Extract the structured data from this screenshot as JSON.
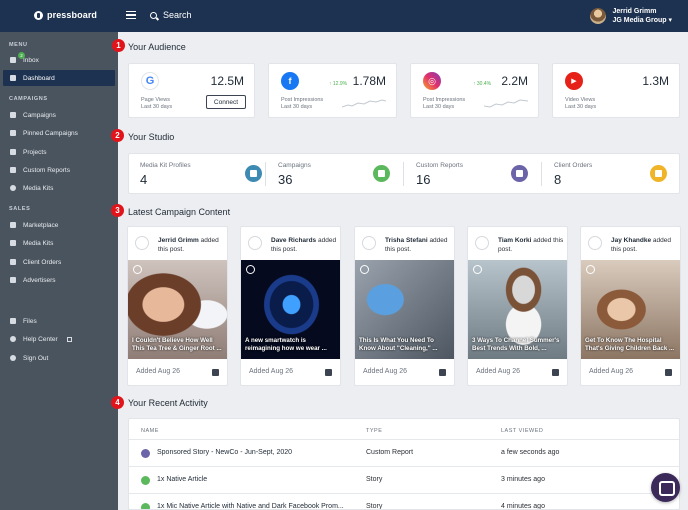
{
  "topbar": {
    "logo": "pressboard",
    "search_label": "Search",
    "user_name": "Jerrid Grimm",
    "org_name": "JG Media Group ▾"
  },
  "sidebar": {
    "menu_heading": "MENU",
    "inbox": "Inbox",
    "inbox_badge": "2",
    "dashboard": "Dashboard",
    "campaigns_heading": "CAMPAIGNS",
    "campaigns": "Campaigns",
    "pinned": "Pinned Campaigns",
    "projects": "Projects",
    "custom_reports": "Custom Reports",
    "media_kits": "Media Kits",
    "sales_heading": "SALES",
    "marketplace": "Marketplace",
    "media_kits_sales": "Media Kits",
    "client_orders": "Client Orders",
    "advertisers": "Advertisers",
    "files": "Files",
    "help_center": "Help Center",
    "sign_out": "Sign Out"
  },
  "steps": [
    "1",
    "2",
    "3",
    "4"
  ],
  "audience": {
    "title": "Your Audience",
    "google": {
      "value": "12.5M",
      "label1": "Page Views",
      "label2": "Last 30 days",
      "button": "Connect"
    },
    "facebook": {
      "value": "1.78M",
      "pct": "↑ 12.9%",
      "label1": "Post Impressions",
      "label2": "Last 30 days"
    },
    "instagram": {
      "value": "2.2M",
      "pct": "↑ 30.4%",
      "label1": "Post Impressions",
      "label2": "Last 30 days"
    },
    "youtube": {
      "value": "1.3M",
      "label1": "Video Views",
      "label2": "Last 30 days"
    }
  },
  "studio": {
    "title": "Your Studio",
    "items": [
      {
        "label": "Media Kit Profiles",
        "num": "4",
        "color": "#3d8bb3"
      },
      {
        "label": "Campaigns",
        "num": "36",
        "color": "#5cb85c"
      },
      {
        "label": "Custom Reports",
        "num": "16",
        "color": "#6c64a8"
      },
      {
        "label": "Client Orders",
        "num": "8",
        "color": "#f0b429"
      }
    ]
  },
  "content": {
    "title": "Latest Campaign Content",
    "added_suffix": "added this post.",
    "cards": [
      {
        "author": "Jerrid Grimm",
        "headline": "I Couldn't Believe How Well This Tea Tree & Ginger Root ...",
        "added": "Added Aug 26"
      },
      {
        "author": "Dave Richards",
        "headline": "A new smartwatch is reimagining how we wear ...",
        "added": "Added Aug 26"
      },
      {
        "author": "Trisha Stefani",
        "headline": "This Is What You Need To Know About \"Cleaning,\" ...",
        "added": "Added Aug 26"
      },
      {
        "author": "Tiam Korki",
        "headline": "3 Ways To Channel Summer's Best Trends With Bold, ...",
        "added": "Added Aug 26"
      },
      {
        "author": "Jay Khandke",
        "headline": "Get To Know The Hospital That's Giving Children Back ...",
        "added": "Added Aug 26"
      }
    ]
  },
  "activity": {
    "title": "Your Recent Activity",
    "col_name": "NAME",
    "col_type": "TYPE",
    "col_viewed": "LAST VIEWED",
    "rows": [
      {
        "name": "Sponsored Story - NewCo - Jun-Sept, 2020",
        "type": "Custom Report",
        "viewed": "a few seconds ago",
        "color": "#6c64a8"
      },
      {
        "name": "1x Native Article",
        "type": "Story",
        "viewed": "3 minutes ago",
        "color": "#5cb85c"
      },
      {
        "name": "1x Mic Native Article with Native and Dark Facebook Prom...",
        "type": "Story",
        "viewed": "4 minutes ago",
        "color": "#5cb85c"
      }
    ]
  }
}
